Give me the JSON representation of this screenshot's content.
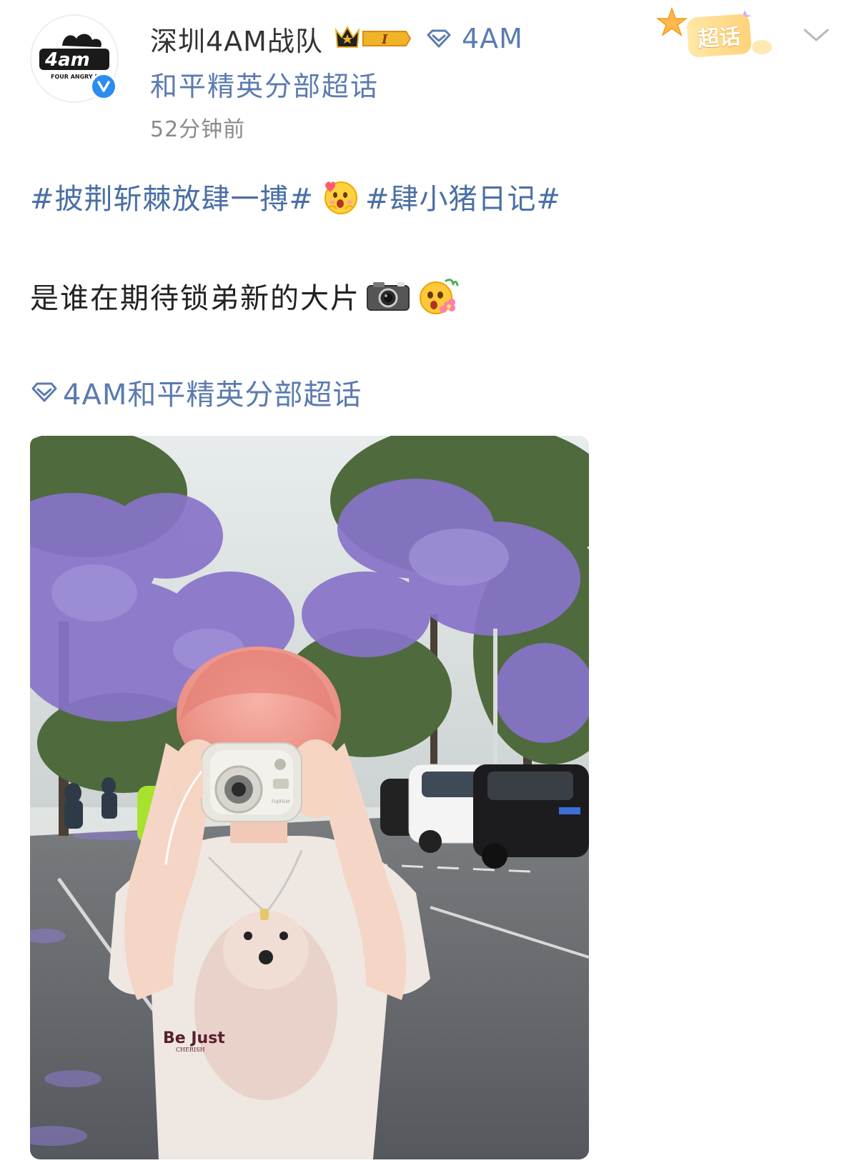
{
  "post": {
    "author": {
      "name": "深圳4AM战队",
      "badge_level": "I",
      "avatar_text": "4am",
      "avatar_subtext": "FOUR ANGRY M",
      "verified": true
    },
    "topic_inline": {
      "line1": "4AM",
      "line2": "和平精英分部超话"
    },
    "timestamp": "52分钟前",
    "supertopic_tag": "超话",
    "hashtag_1": "#披荆斩棘放肆一搏#",
    "hashtag_2": "#肆小猪日记#",
    "message": "是谁在期待锁弟新的大片",
    "topic_link": "4AM和平精英分部超话",
    "photo_shirt_text": "Be Just",
    "photo_shirt_subtext": "CHERISH",
    "photo_camera_brand": "FUJIFILM"
  },
  "colors": {
    "link_blue": "#4a6fa5",
    "topic_blue": "#5b7bb0",
    "verified_blue": "#2d8cf0",
    "timestamp_gray": "#8a8a8a",
    "badge_gold": "#f0b429"
  },
  "icons": {
    "verified": "verified-check-icon",
    "crown": "crown-badge-icon",
    "diamond": "diamond-icon",
    "chevron": "chevron-down-icon",
    "camera": "camera-emoji-icon",
    "face_hug": "hugging-face-emoji-icon",
    "face_flower": "flower-face-emoji-icon"
  }
}
